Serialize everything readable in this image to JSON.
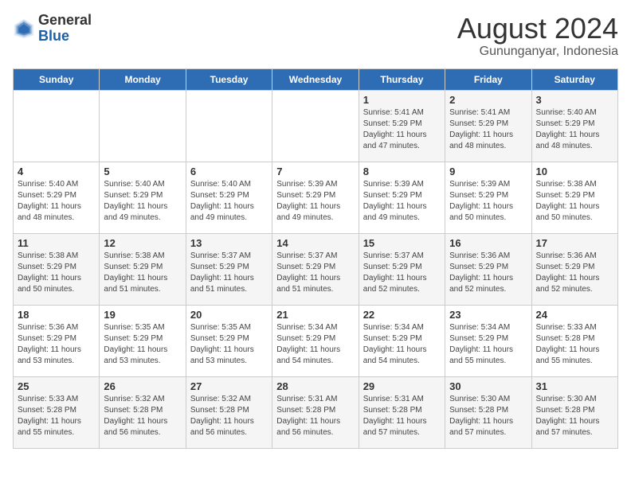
{
  "header": {
    "logo_line1": "General",
    "logo_line2": "Blue",
    "month_year": "August 2024",
    "location": "Gununganyar, Indonesia"
  },
  "weekdays": [
    "Sunday",
    "Monday",
    "Tuesday",
    "Wednesday",
    "Thursday",
    "Friday",
    "Saturday"
  ],
  "weeks": [
    [
      {
        "day": "",
        "sunrise": "",
        "sunset": "",
        "daylight": ""
      },
      {
        "day": "",
        "sunrise": "",
        "sunset": "",
        "daylight": ""
      },
      {
        "day": "",
        "sunrise": "",
        "sunset": "",
        "daylight": ""
      },
      {
        "day": "",
        "sunrise": "",
        "sunset": "",
        "daylight": ""
      },
      {
        "day": "1",
        "sunrise": "Sunrise: 5:41 AM",
        "sunset": "Sunset: 5:29 PM",
        "daylight": "Daylight: 11 hours and 47 minutes."
      },
      {
        "day": "2",
        "sunrise": "Sunrise: 5:41 AM",
        "sunset": "Sunset: 5:29 PM",
        "daylight": "Daylight: 11 hours and 48 minutes."
      },
      {
        "day": "3",
        "sunrise": "Sunrise: 5:40 AM",
        "sunset": "Sunset: 5:29 PM",
        "daylight": "Daylight: 11 hours and 48 minutes."
      }
    ],
    [
      {
        "day": "4",
        "sunrise": "Sunrise: 5:40 AM",
        "sunset": "Sunset: 5:29 PM",
        "daylight": "Daylight: 11 hours and 48 minutes."
      },
      {
        "day": "5",
        "sunrise": "Sunrise: 5:40 AM",
        "sunset": "Sunset: 5:29 PM",
        "daylight": "Daylight: 11 hours and 49 minutes."
      },
      {
        "day": "6",
        "sunrise": "Sunrise: 5:40 AM",
        "sunset": "Sunset: 5:29 PM",
        "daylight": "Daylight: 11 hours and 49 minutes."
      },
      {
        "day": "7",
        "sunrise": "Sunrise: 5:39 AM",
        "sunset": "Sunset: 5:29 PM",
        "daylight": "Daylight: 11 hours and 49 minutes."
      },
      {
        "day": "8",
        "sunrise": "Sunrise: 5:39 AM",
        "sunset": "Sunset: 5:29 PM",
        "daylight": "Daylight: 11 hours and 49 minutes."
      },
      {
        "day": "9",
        "sunrise": "Sunrise: 5:39 AM",
        "sunset": "Sunset: 5:29 PM",
        "daylight": "Daylight: 11 hours and 50 minutes."
      },
      {
        "day": "10",
        "sunrise": "Sunrise: 5:38 AM",
        "sunset": "Sunset: 5:29 PM",
        "daylight": "Daylight: 11 hours and 50 minutes."
      }
    ],
    [
      {
        "day": "11",
        "sunrise": "Sunrise: 5:38 AM",
        "sunset": "Sunset: 5:29 PM",
        "daylight": "Daylight: 11 hours and 50 minutes."
      },
      {
        "day": "12",
        "sunrise": "Sunrise: 5:38 AM",
        "sunset": "Sunset: 5:29 PM",
        "daylight": "Daylight: 11 hours and 51 minutes."
      },
      {
        "day": "13",
        "sunrise": "Sunrise: 5:37 AM",
        "sunset": "Sunset: 5:29 PM",
        "daylight": "Daylight: 11 hours and 51 minutes."
      },
      {
        "day": "14",
        "sunrise": "Sunrise: 5:37 AM",
        "sunset": "Sunset: 5:29 PM",
        "daylight": "Daylight: 11 hours and 51 minutes."
      },
      {
        "day": "15",
        "sunrise": "Sunrise: 5:37 AM",
        "sunset": "Sunset: 5:29 PM",
        "daylight": "Daylight: 11 hours and 52 minutes."
      },
      {
        "day": "16",
        "sunrise": "Sunrise: 5:36 AM",
        "sunset": "Sunset: 5:29 PM",
        "daylight": "Daylight: 11 hours and 52 minutes."
      },
      {
        "day": "17",
        "sunrise": "Sunrise: 5:36 AM",
        "sunset": "Sunset: 5:29 PM",
        "daylight": "Daylight: 11 hours and 52 minutes."
      }
    ],
    [
      {
        "day": "18",
        "sunrise": "Sunrise: 5:36 AM",
        "sunset": "Sunset: 5:29 PM",
        "daylight": "Daylight: 11 hours and 53 minutes."
      },
      {
        "day": "19",
        "sunrise": "Sunrise: 5:35 AM",
        "sunset": "Sunset: 5:29 PM",
        "daylight": "Daylight: 11 hours and 53 minutes."
      },
      {
        "day": "20",
        "sunrise": "Sunrise: 5:35 AM",
        "sunset": "Sunset: 5:29 PM",
        "daylight": "Daylight: 11 hours and 53 minutes."
      },
      {
        "day": "21",
        "sunrise": "Sunrise: 5:34 AM",
        "sunset": "Sunset: 5:29 PM",
        "daylight": "Daylight: 11 hours and 54 minutes."
      },
      {
        "day": "22",
        "sunrise": "Sunrise: 5:34 AM",
        "sunset": "Sunset: 5:29 PM",
        "daylight": "Daylight: 11 hours and 54 minutes."
      },
      {
        "day": "23",
        "sunrise": "Sunrise: 5:34 AM",
        "sunset": "Sunset: 5:29 PM",
        "daylight": "Daylight: 11 hours and 55 minutes."
      },
      {
        "day": "24",
        "sunrise": "Sunrise: 5:33 AM",
        "sunset": "Sunset: 5:28 PM",
        "daylight": "Daylight: 11 hours and 55 minutes."
      }
    ],
    [
      {
        "day": "25",
        "sunrise": "Sunrise: 5:33 AM",
        "sunset": "Sunset: 5:28 PM",
        "daylight": "Daylight: 11 hours and 55 minutes."
      },
      {
        "day": "26",
        "sunrise": "Sunrise: 5:32 AM",
        "sunset": "Sunset: 5:28 PM",
        "daylight": "Daylight: 11 hours and 56 minutes."
      },
      {
        "day": "27",
        "sunrise": "Sunrise: 5:32 AM",
        "sunset": "Sunset: 5:28 PM",
        "daylight": "Daylight: 11 hours and 56 minutes."
      },
      {
        "day": "28",
        "sunrise": "Sunrise: 5:31 AM",
        "sunset": "Sunset: 5:28 PM",
        "daylight": "Daylight: 11 hours and 56 minutes."
      },
      {
        "day": "29",
        "sunrise": "Sunrise: 5:31 AM",
        "sunset": "Sunset: 5:28 PM",
        "daylight": "Daylight: 11 hours and 57 minutes."
      },
      {
        "day": "30",
        "sunrise": "Sunrise: 5:30 AM",
        "sunset": "Sunset: 5:28 PM",
        "daylight": "Daylight: 11 hours and 57 minutes."
      },
      {
        "day": "31",
        "sunrise": "Sunrise: 5:30 AM",
        "sunset": "Sunset: 5:28 PM",
        "daylight": "Daylight: 11 hours and 57 minutes."
      }
    ]
  ]
}
